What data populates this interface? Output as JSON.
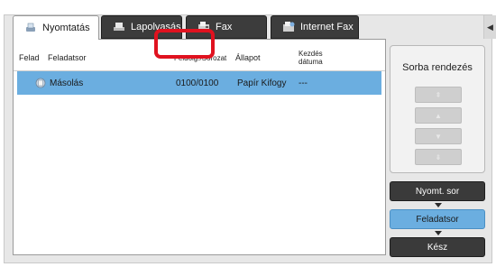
{
  "tabs": [
    {
      "label": "Nyomtatás",
      "icon": "print-icon",
      "active": true
    },
    {
      "label": "Lapolvasás",
      "icon": "scan-icon",
      "active": false
    },
    {
      "label": "Fax",
      "icon": "fax-icon",
      "active": false
    },
    {
      "label": "Internet Fax",
      "icon": "internet-fax-icon",
      "active": false
    }
  ],
  "scroll_arrow": "◀",
  "table": {
    "headers": {
      "job": "Felad",
      "queue": "Feladatsor",
      "sets": "Feldolg./Sorozat",
      "status": "Állapot",
      "start_line1": "Kezdés",
      "start_line2": "dátuma"
    },
    "rows": [
      {
        "name": "Másolás",
        "sets": "0100/0100",
        "status": "Papír Kifogy",
        "start": "---",
        "selected": true
      }
    ]
  },
  "sort": {
    "title": "Sorba rendezés",
    "buttons": [
      "⇞",
      "▲",
      "▼",
      "⇟"
    ]
  },
  "side_buttons": {
    "queue": "Nyomt. sor",
    "job_queue": "Feladatsor",
    "complete": "Kész"
  },
  "colors": {
    "selected": "#6baee0",
    "highlight": "#e0121f",
    "dark_tab": "#3c3c3c"
  }
}
